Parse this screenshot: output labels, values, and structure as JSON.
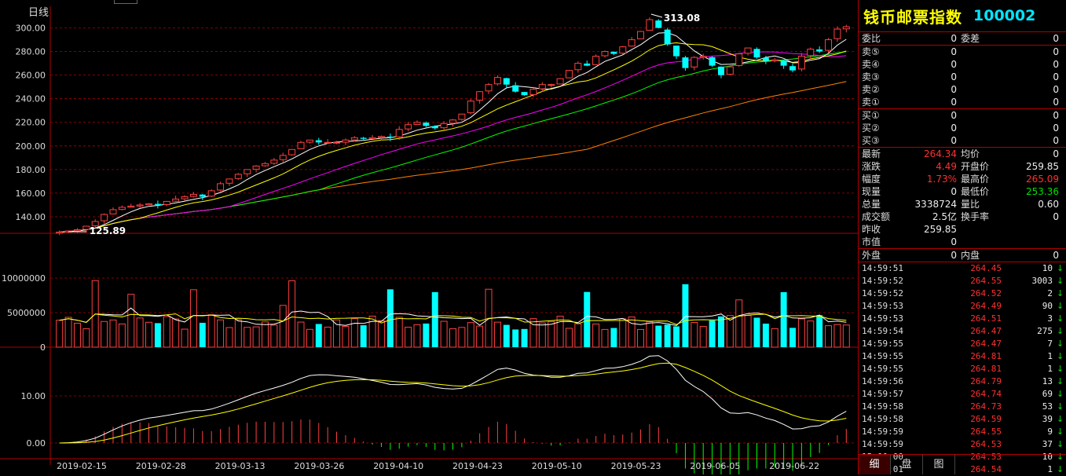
{
  "chart_label": "日线",
  "price_axis": {
    "ticks": [
      "300.00",
      "280.00",
      "260.00",
      "240.00",
      "220.00",
      "200.00",
      "180.00",
      "160.00",
      "140.00"
    ],
    "values": [
      300,
      280,
      260,
      240,
      220,
      200,
      180,
      160,
      140
    ],
    "range": [
      126,
      313
    ],
    "high_marker": "313.08",
    "low_marker": "125.89"
  },
  "volume_axis": {
    "ticks": [
      "10000000",
      "5000000",
      "0"
    ],
    "values": [
      10000000,
      5000000,
      0
    ],
    "range": [
      0,
      15000000
    ]
  },
  "macd_axis": {
    "ticks": [
      "10.00",
      "0.00"
    ],
    "values": [
      10,
      0
    ],
    "range": [
      -3,
      19
    ]
  },
  "date_labels": [
    "2019-02-15",
    "2019-02-28",
    "2019-03-13",
    "2019-03-26",
    "2019-04-10",
    "2019-04-23",
    "2019-05-10",
    "2019-05-23",
    "2019-06-05",
    "2019-06-22"
  ],
  "colors": {
    "up": "#ff4040",
    "down": "#00ffff",
    "ma5": "#ffffff",
    "ma10": "#ffff00",
    "ma20": "#ff00ff",
    "ma30": "#00ff00",
    "ma60": "#ff8000",
    "grid": "#b00000"
  },
  "chart_data": {
    "type": "candlestick",
    "days": 89,
    "price_series": [
      127,
      128,
      129,
      132,
      136,
      142,
      146,
      148,
      149,
      150,
      151,
      150,
      153,
      155,
      157,
      159,
      157,
      162,
      168,
      172,
      176,
      180,
      183,
      185,
      188,
      192,
      197,
      203,
      205,
      203,
      203,
      203,
      205,
      207,
      206,
      207,
      208,
      207,
      214,
      218,
      220,
      217,
      215,
      219,
      222,
      227,
      238,
      246,
      252,
      258,
      252,
      246,
      243,
      248,
      252,
      252,
      257,
      264,
      270,
      268,
      276,
      280,
      278,
      284,
      290,
      297,
      307,
      300,
      286,
      276,
      266,
      275,
      276,
      268,
      260,
      267,
      278,
      283,
      275,
      272,
      273,
      268,
      264,
      276,
      282,
      280,
      290,
      299,
      301
    ]
  },
  "panel": {
    "name": "钱币邮票指数",
    "code": "100002",
    "order_rows": [
      {
        "l": "委比",
        "v": "0",
        "l2": "委差",
        "v2": "0"
      }
    ],
    "sell_rows": [
      {
        "l": "卖⑤",
        "v": "0",
        "v2": "0"
      },
      {
        "l": "卖④",
        "v": "0",
        "v2": "0"
      },
      {
        "l": "卖③",
        "v": "0",
        "v2": "0"
      },
      {
        "l": "卖②",
        "v": "0",
        "v2": "0"
      },
      {
        "l": "卖①",
        "v": "0",
        "v2": "0"
      }
    ],
    "buy_rows": [
      {
        "l": "买①",
        "v": "0",
        "v2": "0"
      },
      {
        "l": "买②",
        "v": "0",
        "v2": "0"
      },
      {
        "l": "买③",
        "v": "0",
        "v2": "0"
      }
    ],
    "quote_rows": [
      {
        "l": "最新",
        "v": "264.34",
        "vc": "red",
        "l2": "均价",
        "v2": "0",
        "v2c": "white"
      },
      {
        "l": "涨跌",
        "v": "4.49",
        "vc": "red",
        "l2": "开盘价",
        "v2": "259.85",
        "v2c": "white"
      },
      {
        "l": "幅度",
        "v": "1.73%",
        "vc": "red",
        "l2": "最高价",
        "v2": "265.09",
        "v2c": "red"
      },
      {
        "l": "现量",
        "v": "0",
        "vc": "white",
        "l2": "最低价",
        "v2": "253.36",
        "v2c": "green"
      },
      {
        "l": "总量",
        "v": "3338724",
        "vc": "white",
        "l2": "量比",
        "v2": "0.60",
        "v2c": "white"
      },
      {
        "l": "成交额",
        "v": "2.5亿",
        "vc": "white",
        "l2": "换手率",
        "v2": "0",
        "v2c": "white"
      },
      {
        "l": "昨收",
        "v": "259.85",
        "vc": "white",
        "l2": "",
        "v2": "",
        "v2c": "white"
      },
      {
        "l": "市值",
        "v": "0",
        "vc": "white",
        "l2": "",
        "v2": "",
        "v2c": "white"
      }
    ],
    "outer": {
      "l": "外盘",
      "v": "0",
      "l2": "内盘",
      "v2": "0"
    },
    "ticks": [
      {
        "t": "14:59:51",
        "p": "264.45",
        "v": "10",
        "a": "↓"
      },
      {
        "t": "14:59:52",
        "p": "264.55",
        "v": "3003",
        "a": "↓"
      },
      {
        "t": "14:59:52",
        "p": "264.52",
        "v": "2",
        "a": "↓"
      },
      {
        "t": "14:59:53",
        "p": "264.49",
        "v": "90",
        "a": "↓"
      },
      {
        "t": "14:59:53",
        "p": "264.51",
        "v": "3",
        "a": "↓"
      },
      {
        "t": "14:59:54",
        "p": "264.47",
        "v": "275",
        "a": "↓"
      },
      {
        "t": "14:59:55",
        "p": "264.47",
        "v": "7",
        "a": "↓"
      },
      {
        "t": "14:59:55",
        "p": "264.81",
        "v": "1",
        "a": "↓"
      },
      {
        "t": "14:59:55",
        "p": "264.81",
        "v": "1",
        "a": "↓"
      },
      {
        "t": "14:59:56",
        "p": "264.79",
        "v": "13",
        "a": "↓"
      },
      {
        "t": "14:59:57",
        "p": "264.74",
        "v": "69",
        "a": "↓"
      },
      {
        "t": "14:59:58",
        "p": "264.73",
        "v": "53",
        "a": "↓"
      },
      {
        "t": "14:59:58",
        "p": "264.59",
        "v": "39",
        "a": "↓"
      },
      {
        "t": "14:59:59",
        "p": "264.55",
        "v": "9",
        "a": "↓"
      },
      {
        "t": "14:59:59",
        "p": "264.53",
        "v": "37",
        "a": "↓"
      },
      {
        "t": "15:00:00",
        "p": "264.53",
        "v": "10",
        "a": "↓"
      },
      {
        "t": "15:00:01",
        "p": "264.54",
        "v": "1",
        "a": "↓"
      }
    ],
    "tabs": [
      "细",
      "盘",
      "图"
    ]
  }
}
